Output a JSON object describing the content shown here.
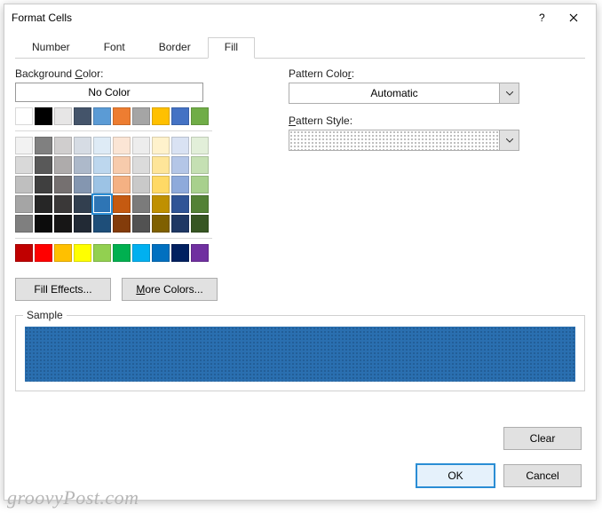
{
  "titlebar": {
    "title": "Format Cells"
  },
  "tabs": [
    "Number",
    "Font",
    "Border",
    "Fill"
  ],
  "active_tab": "Fill",
  "left": {
    "bg_label_pre": "Background ",
    "bg_label_u": "C",
    "bg_label_post": "olor:",
    "no_color": "No Color",
    "fill_effects_pre": "Fill Effects",
    "fill_effects_u": "",
    "fill_effects_post": "...",
    "fill_effects_label": "Fill Effects...",
    "more_colors_pre": "",
    "more_colors_u": "M",
    "more_colors_post": "ore Colors..."
  },
  "right": {
    "pcolor_label_pre": "Pattern Colo",
    "pcolor_label_u": "r",
    "pcolor_label_post": ":",
    "pcolor_value": "Automatic",
    "pstyle_label_pre": "",
    "pstyle_label_u": "P",
    "pstyle_label_post": "attern Style:"
  },
  "sample": {
    "legend": "Sample",
    "color": "#2a6fb0"
  },
  "buttons": {
    "clear": "Clear",
    "ok": "OK",
    "cancel": "Cancel"
  },
  "watermark": "groovyPost.com",
  "palette": {
    "row1": [
      "#ffffff",
      "#000000",
      "#e7e6e6",
      "#44546a",
      "#5b9bd5",
      "#ed7d31",
      "#a5a5a5",
      "#ffc000",
      "#4472c4",
      "#70ad47"
    ],
    "theme": [
      [
        "#f2f2f2",
        "#808080",
        "#d0cece",
        "#d6dce4",
        "#deebf6",
        "#fbe5d5",
        "#ededed",
        "#fff2cc",
        "#d9e2f3",
        "#e2efd9"
      ],
      [
        "#d9d9d9",
        "#595959",
        "#aeabab",
        "#adb9ca",
        "#bdd7ee",
        "#f7cbac",
        "#dbdbdb",
        "#fee599",
        "#b4c6e7",
        "#c5e0b3"
      ],
      [
        "#bfbfbf",
        "#3f3f3f",
        "#757070",
        "#8496b0",
        "#9cc3e5",
        "#f4b183",
        "#c9c9c9",
        "#ffd965",
        "#8eaadb",
        "#a8d08d"
      ],
      [
        "#a5a5a5",
        "#262626",
        "#3a3838",
        "#323f4f",
        "#2e75b5",
        "#c55a11",
        "#7b7b7b",
        "#bf9000",
        "#2f5496",
        "#538135"
      ],
      [
        "#7f7f7f",
        "#0c0c0c",
        "#171616",
        "#222a35",
        "#1e4e79",
        "#833c0b",
        "#525252",
        "#7f6000",
        "#1f3864",
        "#375623"
      ]
    ],
    "standard": [
      "#c00000",
      "#ff0000",
      "#ffc000",
      "#ffff00",
      "#92d050",
      "#00b050",
      "#00b0f0",
      "#0070c0",
      "#002060",
      "#7030a0"
    ],
    "selected": "#2e75b5"
  }
}
